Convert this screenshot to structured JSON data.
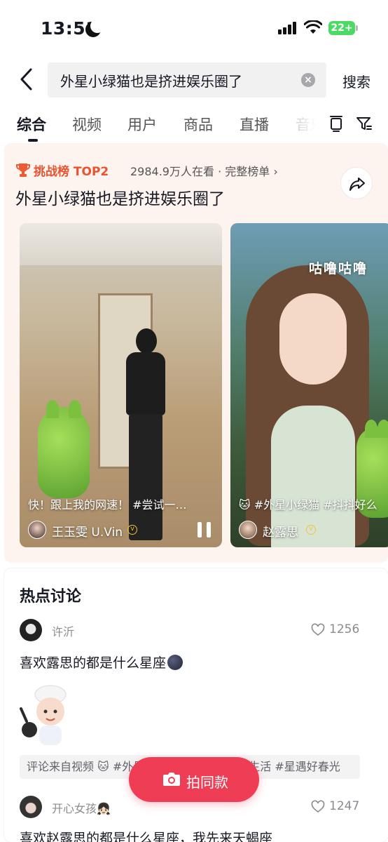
{
  "status_bar": {
    "time": "13:51",
    "battery": "22+"
  },
  "search": {
    "query": "外星小绿猫也是挤进娱乐圈了",
    "button_label": "搜索"
  },
  "tabs": [
    {
      "label": "综合"
    },
    {
      "label": "视频"
    },
    {
      "label": "用户"
    },
    {
      "label": "商品"
    },
    {
      "label": "直播"
    },
    {
      "label": "音乐"
    }
  ],
  "challenge": {
    "rank_label": "挑战榜 TOP2",
    "meta": "2984.9万人在看 · 完整榜单 ›",
    "title": "外星小绿猫也是挤进娱乐圈了",
    "videos": [
      {
        "caption": "快！跟上我的网速！ #尝试一…",
        "author": "王玉雯 U.Vin"
      },
      {
        "caption": "🐱 #外星小绿猫 #抖抖好么",
        "author": "赵露思",
        "sticker": "咕噜咕噜"
      }
    ]
  },
  "hot_discussion": {
    "title": "热点讨论",
    "comments": [
      {
        "user": "许沂",
        "likes": "1256",
        "text": "喜欢露思的都是什么星座",
        "source": "评论来自视频 🐱 #外星小绿猫 #抖抖好么 #生活 #星遇好春光"
      },
      {
        "user": "开心女孩👧🏻",
        "likes": "1247",
        "text": "喜欢赵露思的都是什么星座，我先来天蝎座"
      }
    ]
  },
  "record_button": {
    "label": "拍同款"
  },
  "colors": {
    "accent": "#ee3d55",
    "rank": "#e8542f",
    "card_bg": "#fdf3ef"
  }
}
